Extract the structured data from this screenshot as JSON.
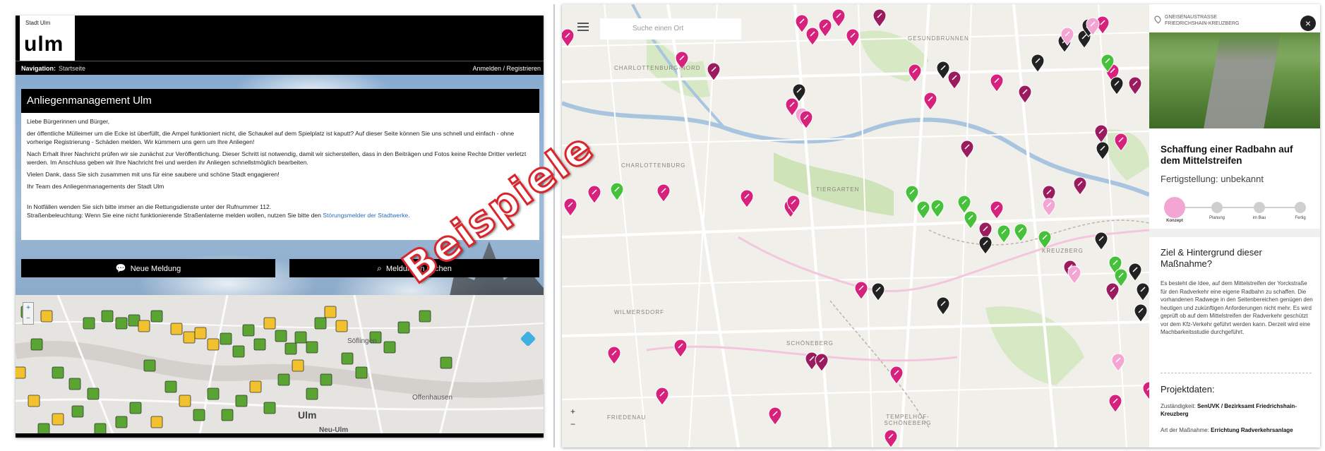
{
  "ulm": {
    "logo_small": "Stadt Ulm",
    "logo_big": "ulm",
    "nav_label": "Navigation:",
    "nav_crumb": "Startseite",
    "login": "Anmelden / Registrieren",
    "card_title": "Anliegenmanagement Ulm",
    "greeting": "Liebe Bürgerinnen und Bürger,",
    "p1": "der öffentliche Mülleimer um die Ecke ist überfüllt, die Ampel funktioniert nicht, die Schaukel auf dem Spielplatz ist kaputt? Auf dieser Seite können Sie uns schnell und einfach - ohne vorherige Registrierung - Schäden melden. Wir kümmern uns gern um Ihre Anliegen!",
    "p2": "Nach Erhalt Ihrer Nachricht prüfen wir sie zunächst zur Veröffentlichung. Dieser Schritt ist notwendig, damit wir sicherstellen, dass in den Beiträgen und Fotos keine Rechte Dritter verletzt werden. Im Anschluss geben wir Ihre Nachricht frei und werden ihr Anliegen schnellstmöglich bearbeiten.",
    "p3": "Vielen Dank, dass Sie sich zusammen mit uns für eine saubere und schöne Stadt engagieren!",
    "p4": "Ihr Team des Anliegenmanagements der Stadt Ulm",
    "p5": "In Notfällen wenden Sie sich bitte immer an die Rettungsdienste unter der Rufnummer 112.",
    "p6_prefix": "Straßenbeleuchtung: Wenn Sie eine nicht funktionierende Straßenlaterne melden wollen, nutzen Sie bitte den ",
    "p6_link": "Störungsmelder der Stadtwerke",
    "p6_suffix": ".",
    "btn_new": "Neue Meldung",
    "btn_search": "Meldungen suchen",
    "map_labels": [
      "Söflingen",
      "Ulm",
      "Offenhausen",
      "Neu-Ulm"
    ],
    "marker_colors": {
      "green": "#5aa532",
      "yellow": "#f2c12e"
    }
  },
  "berlin": {
    "search_placeholder": "Suche einen Ort",
    "districts": [
      "CHARLOTTENBURG-NORD",
      "GESUNDBRUNNEN",
      "CHARLOTTENBURG",
      "TIERGARTEN",
      "KREUZBERG",
      "WILMERSDORF",
      "SCHÖNEBERG",
      "FRIEDENAU",
      "TEMPELHOF-SCHÖNEBERG"
    ],
    "zoom_in": "+",
    "zoom_out": "−",
    "marker_colors": {
      "magenta": "#d6227d",
      "dark_magenta": "#9b1c5e",
      "pink": "#f3a6d3",
      "green": "#47c13c",
      "black": "#222222"
    },
    "side": {
      "street": "GNEISENAUSTRASSE",
      "district": "FRIEDRICHSHAIN-KREUZBERG",
      "close": "×",
      "title": "Schaffung einer Radbahn auf dem Mittelstreifen",
      "status": "Fertigstellung: unbekannt",
      "steps": [
        "Konzept",
        "Planung",
        "im Bau",
        "Fertig"
      ],
      "h_goal": "Ziel & Hintergrund dieser Maßnahme?",
      "goal_text": "Es besteht die Idee, auf dem Mittelstreifen der Yorckstraße für den Radverkehr eine eigene Radbahn zu schaffen. Die vorhandenen Radwege in den Seitenbereichen genügen den heutigen und zukünftigen Anforderungen nicht mehr. Es wird geprüft ob auf dem Mittelstreifen der Radverkehr geschützt vor dem Kfz-Verkehr geführt werden kann. Derzeit wird eine Machbarkeitsstudie durchgeführt.",
      "h_project": "Projektdaten:",
      "resp_label": "Zuständigkeit:",
      "resp_value": "SenUVK / Bezirksamt Friedrichshain-Kreuzberg",
      "type_label": "Art der Maßnahme:",
      "type_value": "Errichtung Radverkehrsanlage"
    }
  },
  "watermark": "Beispiele"
}
